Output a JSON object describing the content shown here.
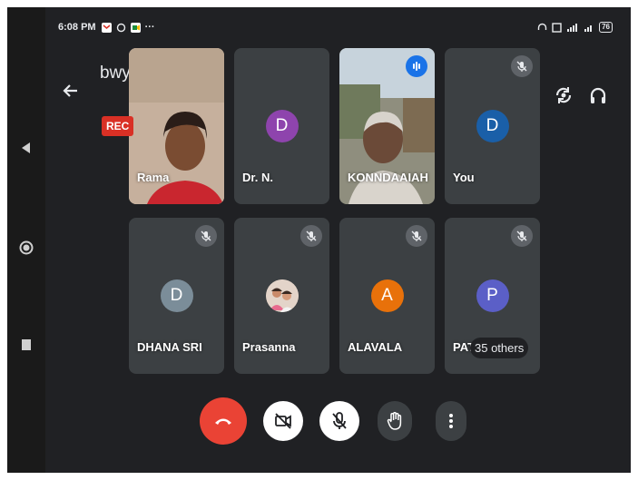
{
  "status": {
    "time": "6:08 PM",
    "more": "···",
    "battery": "76"
  },
  "meeting": {
    "code": "bwy-yqab-dts",
    "recording": "REC"
  },
  "participants": [
    {
      "name": "Rama",
      "type": "video",
      "bg": "#c9b6a4"
    },
    {
      "name": "Dr. N.",
      "type": "avatar",
      "initial": "D",
      "color": "#8e44ad"
    },
    {
      "name": "KONNDAAIAH",
      "type": "video",
      "bg": "#8a7760",
      "speaking": true
    },
    {
      "name": "You",
      "type": "avatar",
      "initial": "D",
      "color": "#1a5fa8",
      "muted": true
    },
    {
      "name": "DHANA SRI",
      "type": "avatar",
      "initial": "D",
      "color": "#7b8d99",
      "muted": true
    },
    {
      "name": "Prasanna",
      "type": "photo",
      "muted": true
    },
    {
      "name": "ALAVALA",
      "type": "avatar",
      "initial": "A",
      "color": "#e8710a",
      "muted": true
    },
    {
      "name": "PAT",
      "type": "avatar",
      "initial": "P",
      "color": "#5b5fc7",
      "muted": true,
      "others": "35 others"
    }
  ],
  "colors": {
    "end_call": "#ea4335",
    "toggle_bg": "#ffffff",
    "dark_btn": "#3c4043",
    "tile": "#3c4043",
    "background": "#202124"
  },
  "icons": {
    "back": "arrow-left-icon",
    "switch_camera": "camera-switch-icon",
    "audio": "headphones-icon",
    "end_call": "phone-hangup-icon",
    "camera": "video-off-icon",
    "mic": "mic-off-icon",
    "hand": "raise-hand-icon",
    "more": "more-vert-icon"
  }
}
